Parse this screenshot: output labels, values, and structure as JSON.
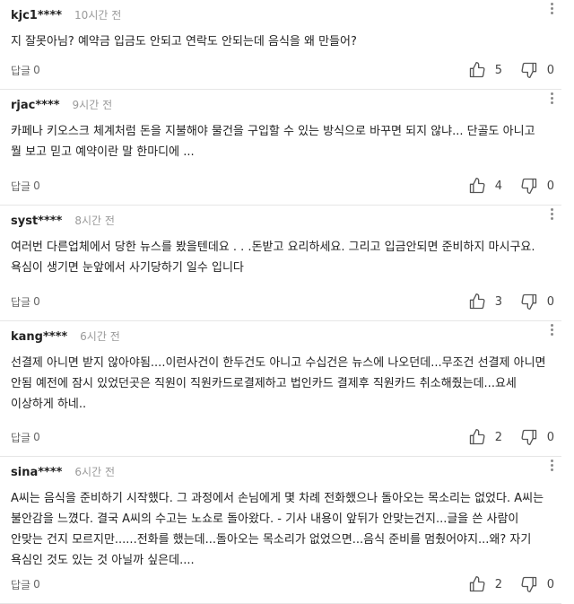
{
  "comments": [
    {
      "user": "kjc1****",
      "time": "10시간 전",
      "text": "지 잘못아님? 예약금 입금도 안되고 연락도 안되는데 음식을 왜 만들어?",
      "reply_label": "답글",
      "reply_count": "0",
      "likes": "5",
      "dislikes": "0"
    },
    {
      "user": "rjac****",
      "time": "9시간 전",
      "text": "카페나 키오스크 체계처럼 돈을 지불해야 물건을 구입할 수 있는 방식으로 바꾸면 되지 않냐... 단골도 아니고 뭘 보고 믿고 예약이란 말 한마디에 ...",
      "reply_label": "답글",
      "reply_count": "0",
      "likes": "4",
      "dislikes": "0"
    },
    {
      "user": "syst****",
      "time": "8시간 전",
      "text": "여러번 다른업체에서 당한 뉴스를 봤을텐데요 . . .돈받고 요리하세요. 그리고 입금안되면 준비하지 마시구요. 욕심이 생기면 눈앞에서 사기당하기 일수 입니다",
      "reply_label": "답글",
      "reply_count": "0",
      "likes": "3",
      "dislikes": "0"
    },
    {
      "user": "kang****",
      "time": "6시간 전",
      "text": "선결제 아니면 받지 않아야됨....이런사건이 한두건도 아니고 수십건은 뉴스에 나오던데...무조건 선결제 아니면 안됨 예전에 잠시 있었던곳은 직원이 직원카드로결제하고 법인카드 결제후 직원카드 취소해줬는데...요세 이상하게 하네..",
      "reply_label": "답글",
      "reply_count": "0",
      "likes": "2",
      "dislikes": "0"
    },
    {
      "user": "sina****",
      "time": "6시간 전",
      "text": "A씨는 음식을 준비하기 시작했다. 그 과정에서 손님에게 몇 차례 전화했으나 돌아오는 목소리는 없었다. A씨는 불안감을 느꼈다. 결국 A씨의 수고는 노쇼로 돌아왔다. - 기사 내용이 앞뒤가 안맞는건지...글을 쓴 사람이 안맞는 건지 모르지만......전화를 했는데...돌아오는 목소리가 없었으면...음식 준비를 멈췄어야지...왜? 자기 욕심인 것도 있는 것 아닐까 싶은데....",
      "reply_label": "답글",
      "reply_count": "0",
      "likes": "2",
      "dislikes": "0"
    }
  ],
  "icons": {
    "more": "more-vertical-icon",
    "like": "thumbs-up-icon",
    "dislike": "thumbs-down-icon"
  },
  "colors": {
    "text": "#222222",
    "muted": "#9a9a9a",
    "divider": "#e6e6e6",
    "icon": "#555555"
  }
}
